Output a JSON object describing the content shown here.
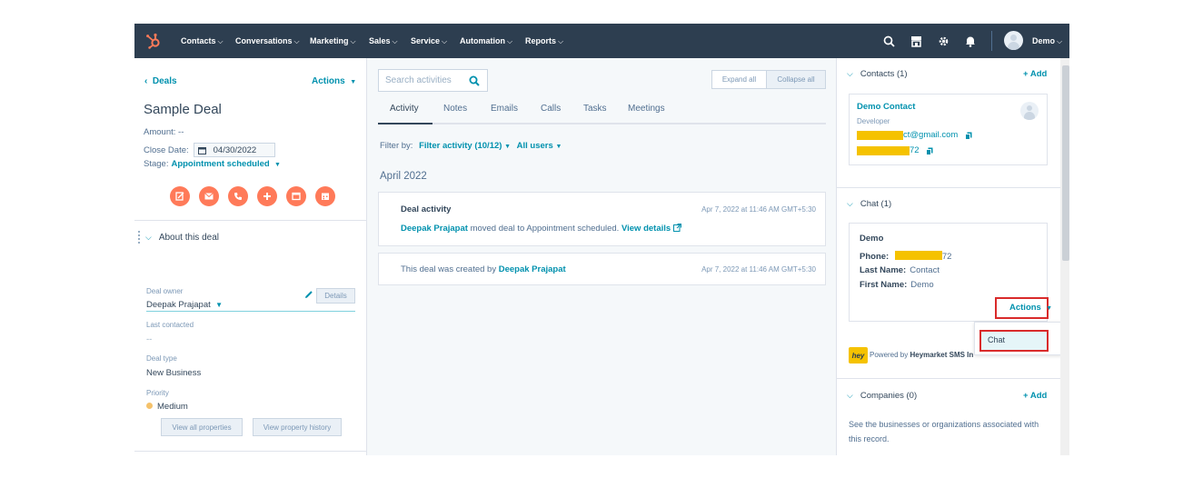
{
  "nav": {
    "items": [
      "Contacts",
      "Conversations",
      "Marketing",
      "Sales",
      "Service",
      "Automation",
      "Reports"
    ],
    "user_name": "Demo",
    "icons": [
      "search-icon",
      "marketplace-icon",
      "settings-icon",
      "notifications-icon"
    ]
  },
  "left": {
    "back_label": "Deals",
    "actions_label": "Actions",
    "deal_title": "Sample Deal",
    "amount_label": "Amount:",
    "amount_value": "--",
    "close_date_label": "Close Date:",
    "close_date_value": "04/30/2022",
    "stage_label": "Stage:",
    "stage_value": "Appointment scheduled",
    "quick_actions": [
      "note-icon",
      "email-icon",
      "call-icon",
      "add-icon",
      "task-icon",
      "meeting-icon"
    ],
    "about_title": "About this deal",
    "deal_owner_label": "Deal owner",
    "deal_owner_value": "Deepak Prajapat",
    "details_label": "Details",
    "last_contacted_label": "Last contacted",
    "last_contacted_value": "--",
    "deal_type_label": "Deal type",
    "deal_type_value": "New Business",
    "priority_label": "Priority",
    "priority_value": "Medium",
    "view_all_label": "View all properties",
    "view_history_label": "View property history"
  },
  "middle": {
    "search_placeholder": "Search activities",
    "expand_all": "Expand all",
    "collapse_all": "Collapse all",
    "tabs": [
      "Activity",
      "Notes",
      "Emails",
      "Calls",
      "Tasks",
      "Meetings"
    ],
    "filter_by_label": "Filter by:",
    "filter_activity": "Filter activity (10/12)",
    "all_users": "All users",
    "month": "April 2022",
    "card1": {
      "title": "Deal activity",
      "time": "Apr 7, 2022 at 11:46 AM GMT+5:30",
      "actor": "Deepak Prajapat",
      "text": "moved deal to Appointment scheduled.",
      "link": "View details"
    },
    "card2": {
      "text": "This deal was created by",
      "actor": "Deepak Prajapat",
      "time": "Apr 7, 2022 at 11:46 AM GMT+5:30"
    }
  },
  "right": {
    "contacts_title": "Contacts (1)",
    "add_label": "+ Add",
    "contact_name": "Demo Contact",
    "contact_role": "Developer",
    "contact_email_visible": "ct@gmail.com",
    "contact_phone_visible": "72",
    "chat_title": "Chat (1)",
    "chat_name": "Demo",
    "phone_label": "Phone:",
    "phone_visible": "72",
    "last_name_label": "Last Name:",
    "last_name_value": "Contact",
    "first_name_label": "First Name:",
    "first_name_value": "Demo",
    "chat_actions_label": "Actions",
    "dropdown_chat": "Chat",
    "powered_by_prefix": "Powered by",
    "powered_by_name": "Heymarket SMS In",
    "logo_text": "hey",
    "companies_title": "Companies (0)",
    "companies_add": "+ Add",
    "companies_desc": "See the businesses or organizations associated with this record."
  },
  "colors": {
    "nav_bg": "#2d3e50",
    "accent": "#0091ae",
    "orange": "#ff7a59",
    "highlight_red": "#d92b2b",
    "redaction": "#f5c200"
  }
}
